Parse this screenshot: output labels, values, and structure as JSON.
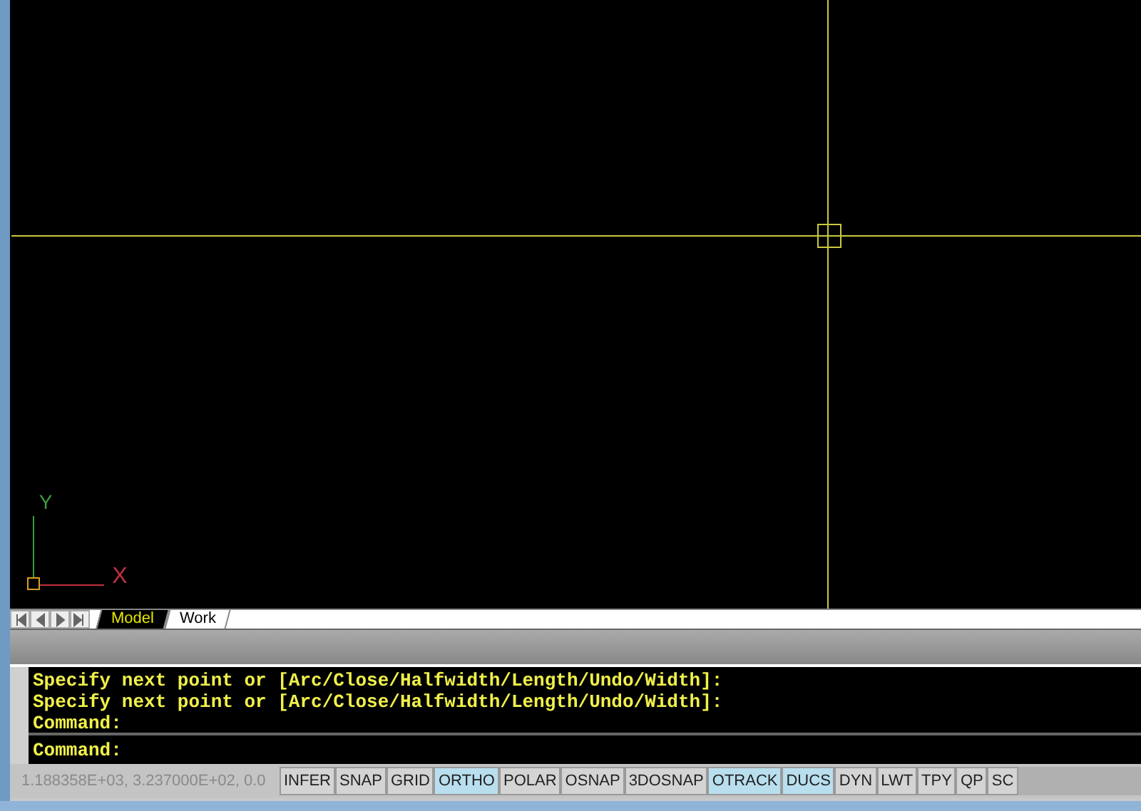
{
  "drawing_area": {
    "ucs_icon": {
      "x_label": "X",
      "y_label": "Y"
    }
  },
  "layout_tabs": [
    {
      "label": "Model",
      "selected": true
    },
    {
      "label": "Work",
      "selected": false
    }
  ],
  "command_history": [
    "Specify next point or [Arc/Close/Halfwidth/Length/Undo/Width]:",
    "Specify next point or [Arc/Close/Halfwidth/Length/Undo/Width]:",
    "Command:"
  ],
  "command_line": {
    "prompt": "Command:"
  },
  "status_bar": {
    "coordinates": "1.188358E+03, 3.237000E+02, 0.0",
    "toggles": [
      {
        "label": "INFER",
        "on": false
      },
      {
        "label": "SNAP",
        "on": false
      },
      {
        "label": "GRID",
        "on": false
      },
      {
        "label": "ORTHO",
        "on": true
      },
      {
        "label": "POLAR",
        "on": false
      },
      {
        "label": "OSNAP",
        "on": false
      },
      {
        "label": "3DOSNAP",
        "on": false
      },
      {
        "label": "OTRACK",
        "on": true
      },
      {
        "label": "DUCS",
        "on": true
      },
      {
        "label": "DYN",
        "on": false
      },
      {
        "label": "LWT",
        "on": false
      },
      {
        "label": "TPY",
        "on": false
      },
      {
        "label": "QP",
        "on": false
      },
      {
        "label": "SC",
        "on": false
      }
    ]
  }
}
